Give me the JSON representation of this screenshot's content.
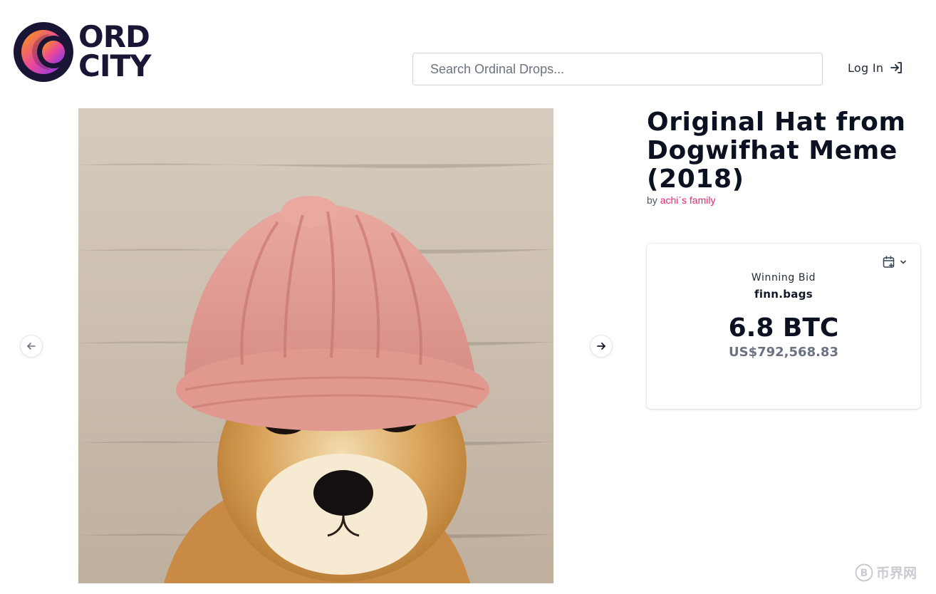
{
  "brand": {
    "name_line1": "ORD",
    "name_line2": "CITY"
  },
  "search": {
    "placeholder": "Search Ordinal Drops..."
  },
  "header": {
    "login_label": "Log In"
  },
  "carousel": {
    "prev_icon": "arrow-left-icon",
    "next_icon": "arrow-right-icon"
  },
  "item": {
    "title": "Original Hat from Dogwifhat Meme (2018)",
    "by_prefix": "by",
    "artist": "achi´s family"
  },
  "bid": {
    "label": "Winning Bid",
    "bidder": "finn.bags",
    "amount": "6.8 BTC",
    "fiat": "US$792,568.83",
    "calendar_icon": "calendar-plus-icon"
  },
  "watermark": {
    "text": "币界网"
  },
  "colors": {
    "accent": "#db2777",
    "brand_dark": "#1b1535",
    "text_dark": "#0b1120",
    "muted": "#6b7280"
  }
}
